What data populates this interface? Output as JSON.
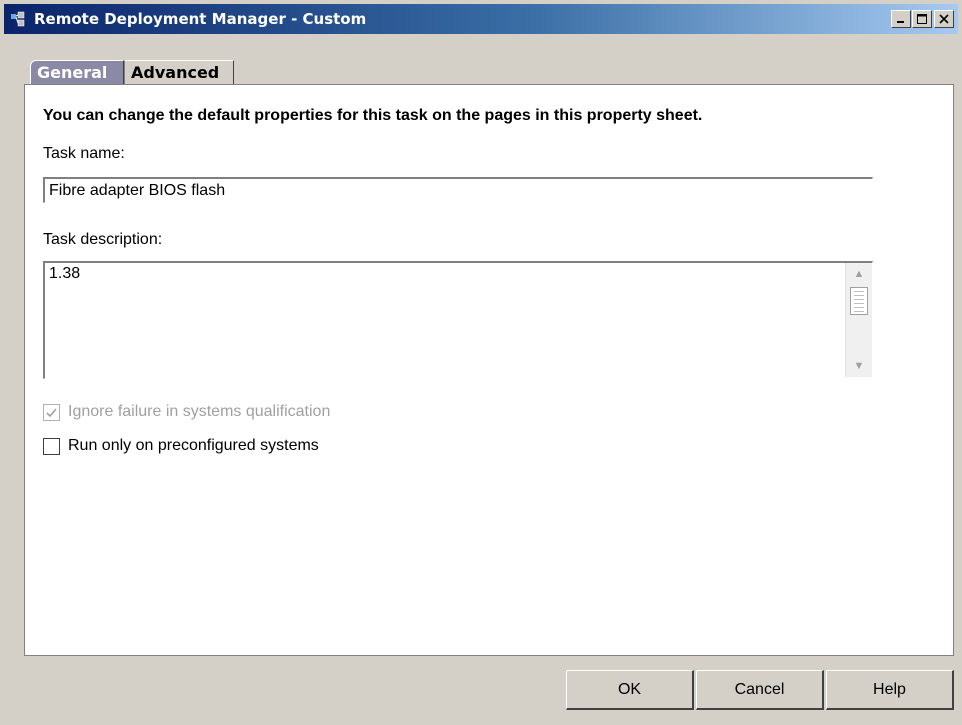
{
  "window": {
    "title": "Remote Deployment Manager - Custom",
    "minimize_label": "_",
    "maximize_label": "□",
    "close_label": "X"
  },
  "tabs": [
    {
      "label": "General",
      "active": true
    },
    {
      "label": "Advanced",
      "active": false
    }
  ],
  "general": {
    "intro": "You can change the default properties for this task on the pages in this property sheet.",
    "task_name_label": "Task name:",
    "task_name_value": "Fibre adapter BIOS flash",
    "task_description_label": "Task description:",
    "task_description_value": "1.38",
    "ignore_failure_label": "Ignore failure in systems qualification",
    "ignore_failure_checked": true,
    "ignore_failure_enabled": false,
    "run_only_label": "Run only on preconfigured systems",
    "run_only_checked": false
  },
  "buttons": {
    "ok": "OK",
    "cancel": "Cancel",
    "help": "Help"
  },
  "colors": {
    "titlebar_start": "#0a246a",
    "titlebar_end": "#a6caf0",
    "active_tab": "#8a8aa6",
    "face": "#d4d0c8"
  }
}
